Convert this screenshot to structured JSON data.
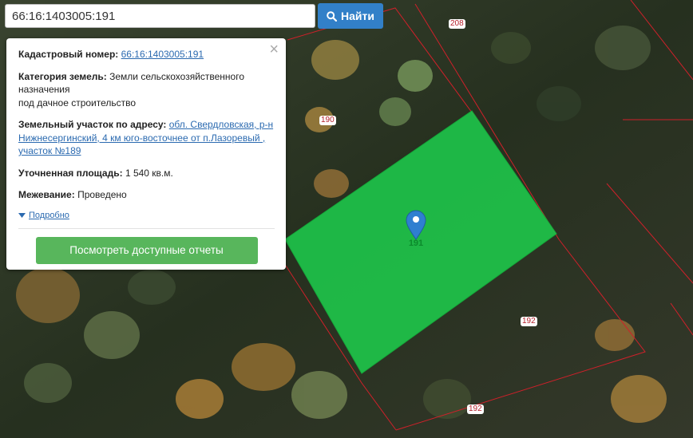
{
  "search": {
    "value": "66:16:1403005:191",
    "button_label": "Найти"
  },
  "popup": {
    "cadastral_label": "Кадастровый номер:",
    "cadastral_value": "66:16:1403005:191",
    "category_label": "Категория земель:",
    "category_value_line1": "Земли сельскохозяйственного назначения",
    "category_value_line2": "под дачное строительство",
    "address_label": "Земельный участок по адресу:",
    "address_value": "обл. Свердловская, р-н Нижнесергинский, 4 км юго-восточнее от п.Лазоревый , участок №189",
    "area_label": "Уточненная площадь:",
    "area_value": "1 540 кв.м.",
    "survey_label": "Межевание:",
    "survey_value": "Проведено",
    "details_link": "Подробно",
    "reports_button": "Посмотреть доступные отчеты"
  },
  "map": {
    "plot_labels": [
      "208",
      "190",
      "192",
      "192"
    ],
    "marker_label": "191",
    "highlight_color": "#1ec74a",
    "boundary_color": "#d0202a"
  }
}
